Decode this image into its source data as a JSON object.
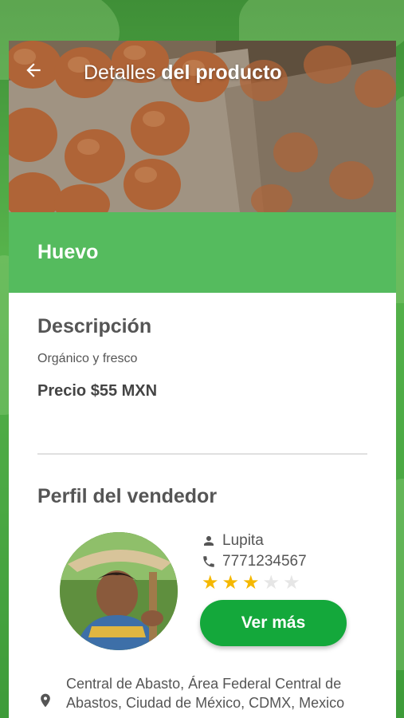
{
  "header": {
    "title_regular": "Detalles",
    "title_bold": "del producto",
    "back_icon": "arrow-left-icon"
  },
  "product": {
    "name": "Huevo",
    "description_title": "Descripción",
    "description": "Orgánico y fresco",
    "price_label": "Precio $55 MXN"
  },
  "seller": {
    "section_title": "Perfil del vendedor",
    "name": "Lupita",
    "phone": "7771234567",
    "rating": 3,
    "rating_max": 5,
    "more_button": "Ver más",
    "address": "Central de Abasto, Área Federal Central de Abastos, Ciudad de México, CDMX, Mexico"
  },
  "colors": {
    "accent_green": "#55bb5e",
    "button_green": "#14a83b",
    "star_filled": "#f5b800",
    "star_empty": "#e6e6e6",
    "text_gray": "#555555"
  }
}
